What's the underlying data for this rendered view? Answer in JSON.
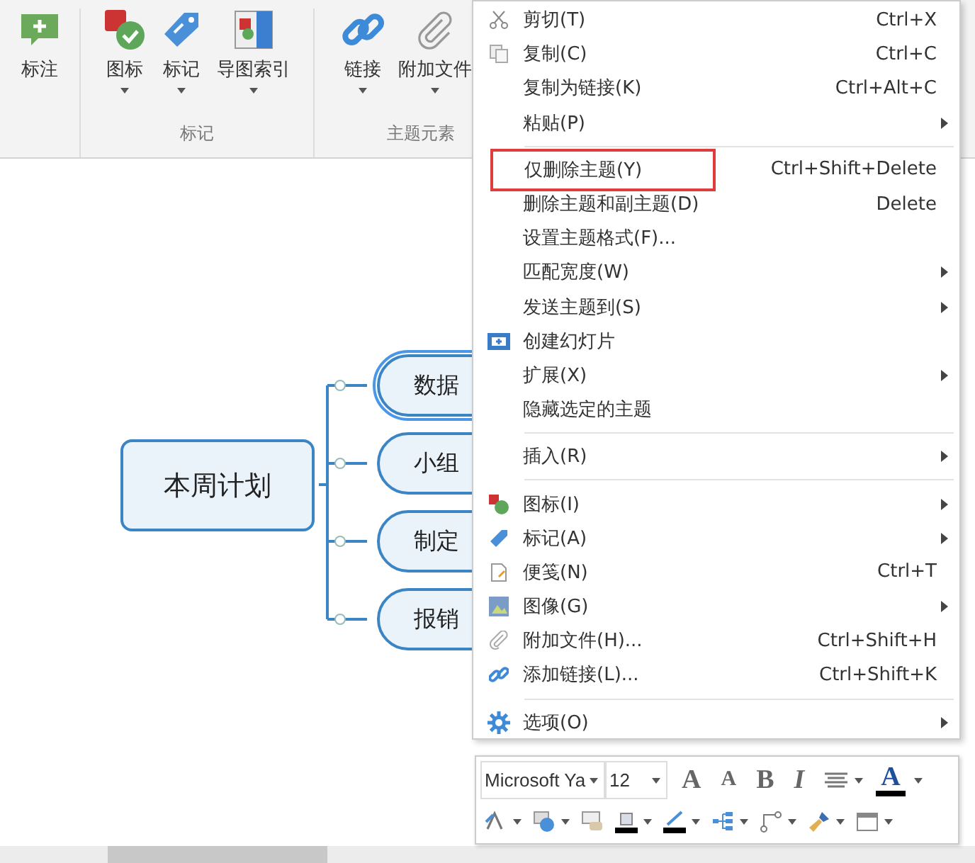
{
  "ribbon": {
    "buttons": [
      {
        "label": "标注",
        "dropdown": false
      },
      {
        "label": "图标",
        "dropdown": true
      },
      {
        "label": "标记",
        "dropdown": true
      },
      {
        "label": "导图索引",
        "dropdown": true
      },
      {
        "label": "链接",
        "dropdown": true
      },
      {
        "label": "附加文件",
        "dropdown": true
      }
    ],
    "groups": [
      "标记",
      "主题元素"
    ]
  },
  "mindmap": {
    "root": "本周计划",
    "topics": [
      {
        "label": "数据",
        "selected": true
      },
      {
        "label": "小组",
        "selected": false
      },
      {
        "label": "制定",
        "selected": false
      },
      {
        "label": "报销",
        "selected": false
      }
    ]
  },
  "context_menu": [
    {
      "kind": "item",
      "label": "剪切(T)",
      "shortcut": "Ctrl+X",
      "submenu": false,
      "outlined": false
    },
    {
      "kind": "item",
      "label": "复制(C)",
      "shortcut": "Ctrl+C",
      "submenu": false,
      "outlined": false
    },
    {
      "kind": "item",
      "label": "复制为链接(K)",
      "shortcut": "Ctrl+Alt+C",
      "submenu": false,
      "outlined": false
    },
    {
      "kind": "item",
      "label": "粘贴(P)",
      "submenu": true,
      "outlined": false
    },
    {
      "kind": "separator"
    },
    {
      "kind": "item",
      "label": "仅删除主题(Y)",
      "shortcut": "Ctrl+Shift+Delete",
      "submenu": false,
      "outlined": true
    },
    {
      "kind": "item",
      "label": "删除主题和副主题(D)",
      "shortcut": "Delete",
      "submenu": false,
      "outlined": false
    },
    {
      "kind": "item",
      "label": "设置主题格式(F)...",
      "submenu": false,
      "outlined": false
    },
    {
      "kind": "item",
      "label": "匹配宽度(W)",
      "submenu": true,
      "outlined": false
    },
    {
      "kind": "item",
      "label": "发送主题到(S)",
      "submenu": true,
      "outlined": false
    },
    {
      "kind": "item",
      "label": "创建幻灯片",
      "submenu": false,
      "outlined": false
    },
    {
      "kind": "item",
      "label": "扩展(X)",
      "submenu": true,
      "outlined": false
    },
    {
      "kind": "item",
      "label": "隐藏选定的主题",
      "submenu": false,
      "outlined": false
    },
    {
      "kind": "separator"
    },
    {
      "kind": "item",
      "label": "插入(R)",
      "submenu": true,
      "outlined": false
    },
    {
      "kind": "separator"
    },
    {
      "kind": "item",
      "label": "图标(I)",
      "submenu": true,
      "outlined": false
    },
    {
      "kind": "item",
      "label": "标记(A)",
      "submenu": true,
      "outlined": false
    },
    {
      "kind": "item",
      "label": "便笺(N)",
      "shortcut": "Ctrl+T",
      "submenu": false,
      "outlined": false
    },
    {
      "kind": "item",
      "label": "图像(G)",
      "submenu": true,
      "outlined": false
    },
    {
      "kind": "item",
      "label": "附加文件(H)...",
      "shortcut": "Ctrl+Shift+H",
      "submenu": false,
      "outlined": false
    },
    {
      "kind": "item",
      "label": "添加链接(L)...",
      "shortcut": "Ctrl+Shift+K",
      "submenu": false,
      "outlined": false
    },
    {
      "kind": "separator"
    },
    {
      "kind": "item",
      "label": "选项(O)",
      "submenu": true,
      "outlined": false
    }
  ],
  "mini_toolbar": {
    "font": "Microsoft Ya",
    "size": "12",
    "format_buttons": [
      "A",
      "A",
      "B",
      "I"
    ],
    "font_color": "A"
  }
}
